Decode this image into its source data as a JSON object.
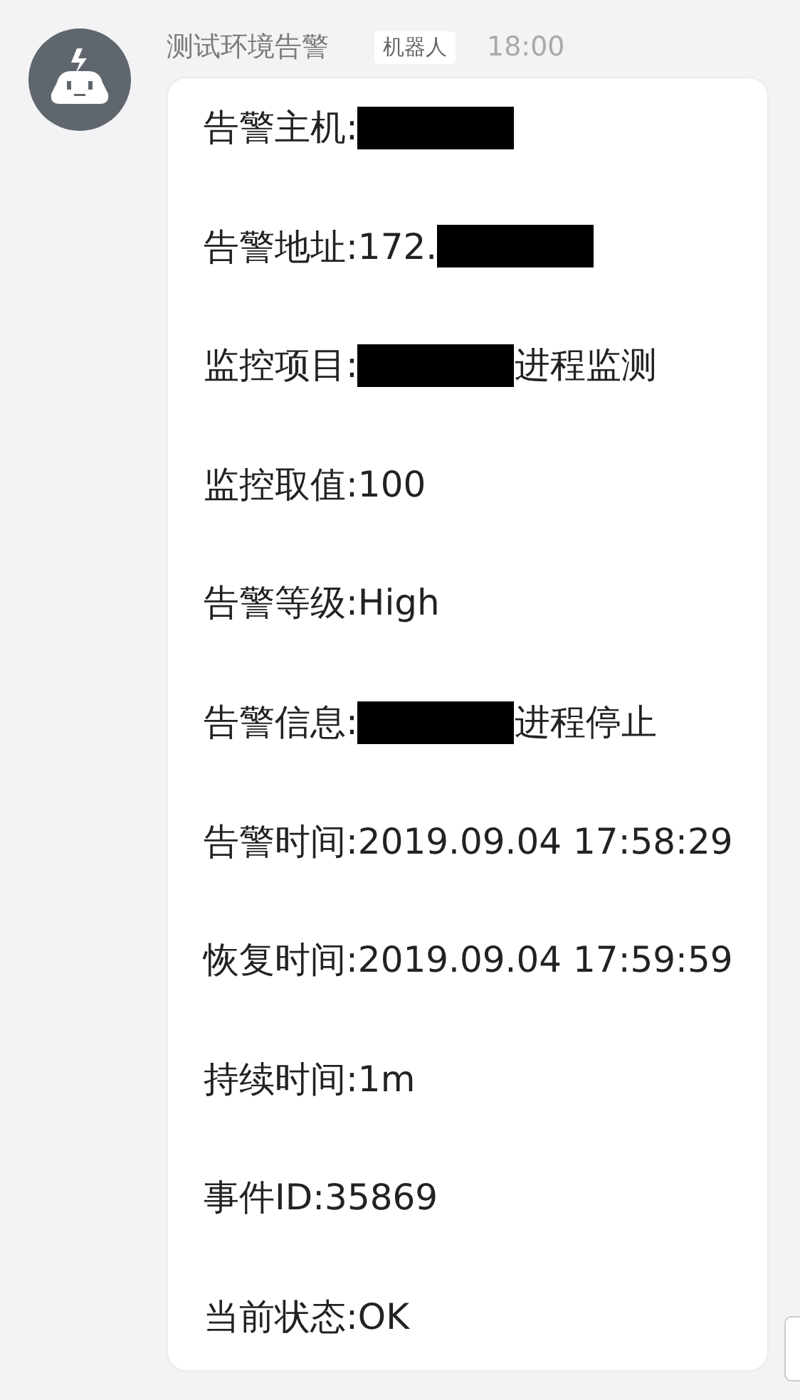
{
  "message": {
    "sender": "测试环境告警",
    "badge": "机器人",
    "time": "18:00",
    "lines": [
      {
        "before": "告警主机:",
        "redacted": true
      },
      {
        "before": "告警地址:172.",
        "redacted": true
      },
      {
        "before": "监控项目:",
        "redacted": true,
        "after": "进程监测"
      },
      {
        "before": "监控取值:100",
        "redacted": false
      },
      {
        "before": "告警等级:High",
        "redacted": false
      },
      {
        "before": "告警信息:",
        "redacted": true,
        "after": "进程停止"
      },
      {
        "before": "告警时间:2019.09.04 17:58:29",
        "redacted": false
      },
      {
        "before": "恢复时间:2019.09.04 17:59:59",
        "redacted": false
      },
      {
        "before": "持续时间:1m",
        "redacted": false
      },
      {
        "before": "事件ID:35869",
        "redacted": false
      },
      {
        "before": "当前状态:OK",
        "redacted": false
      }
    ]
  }
}
